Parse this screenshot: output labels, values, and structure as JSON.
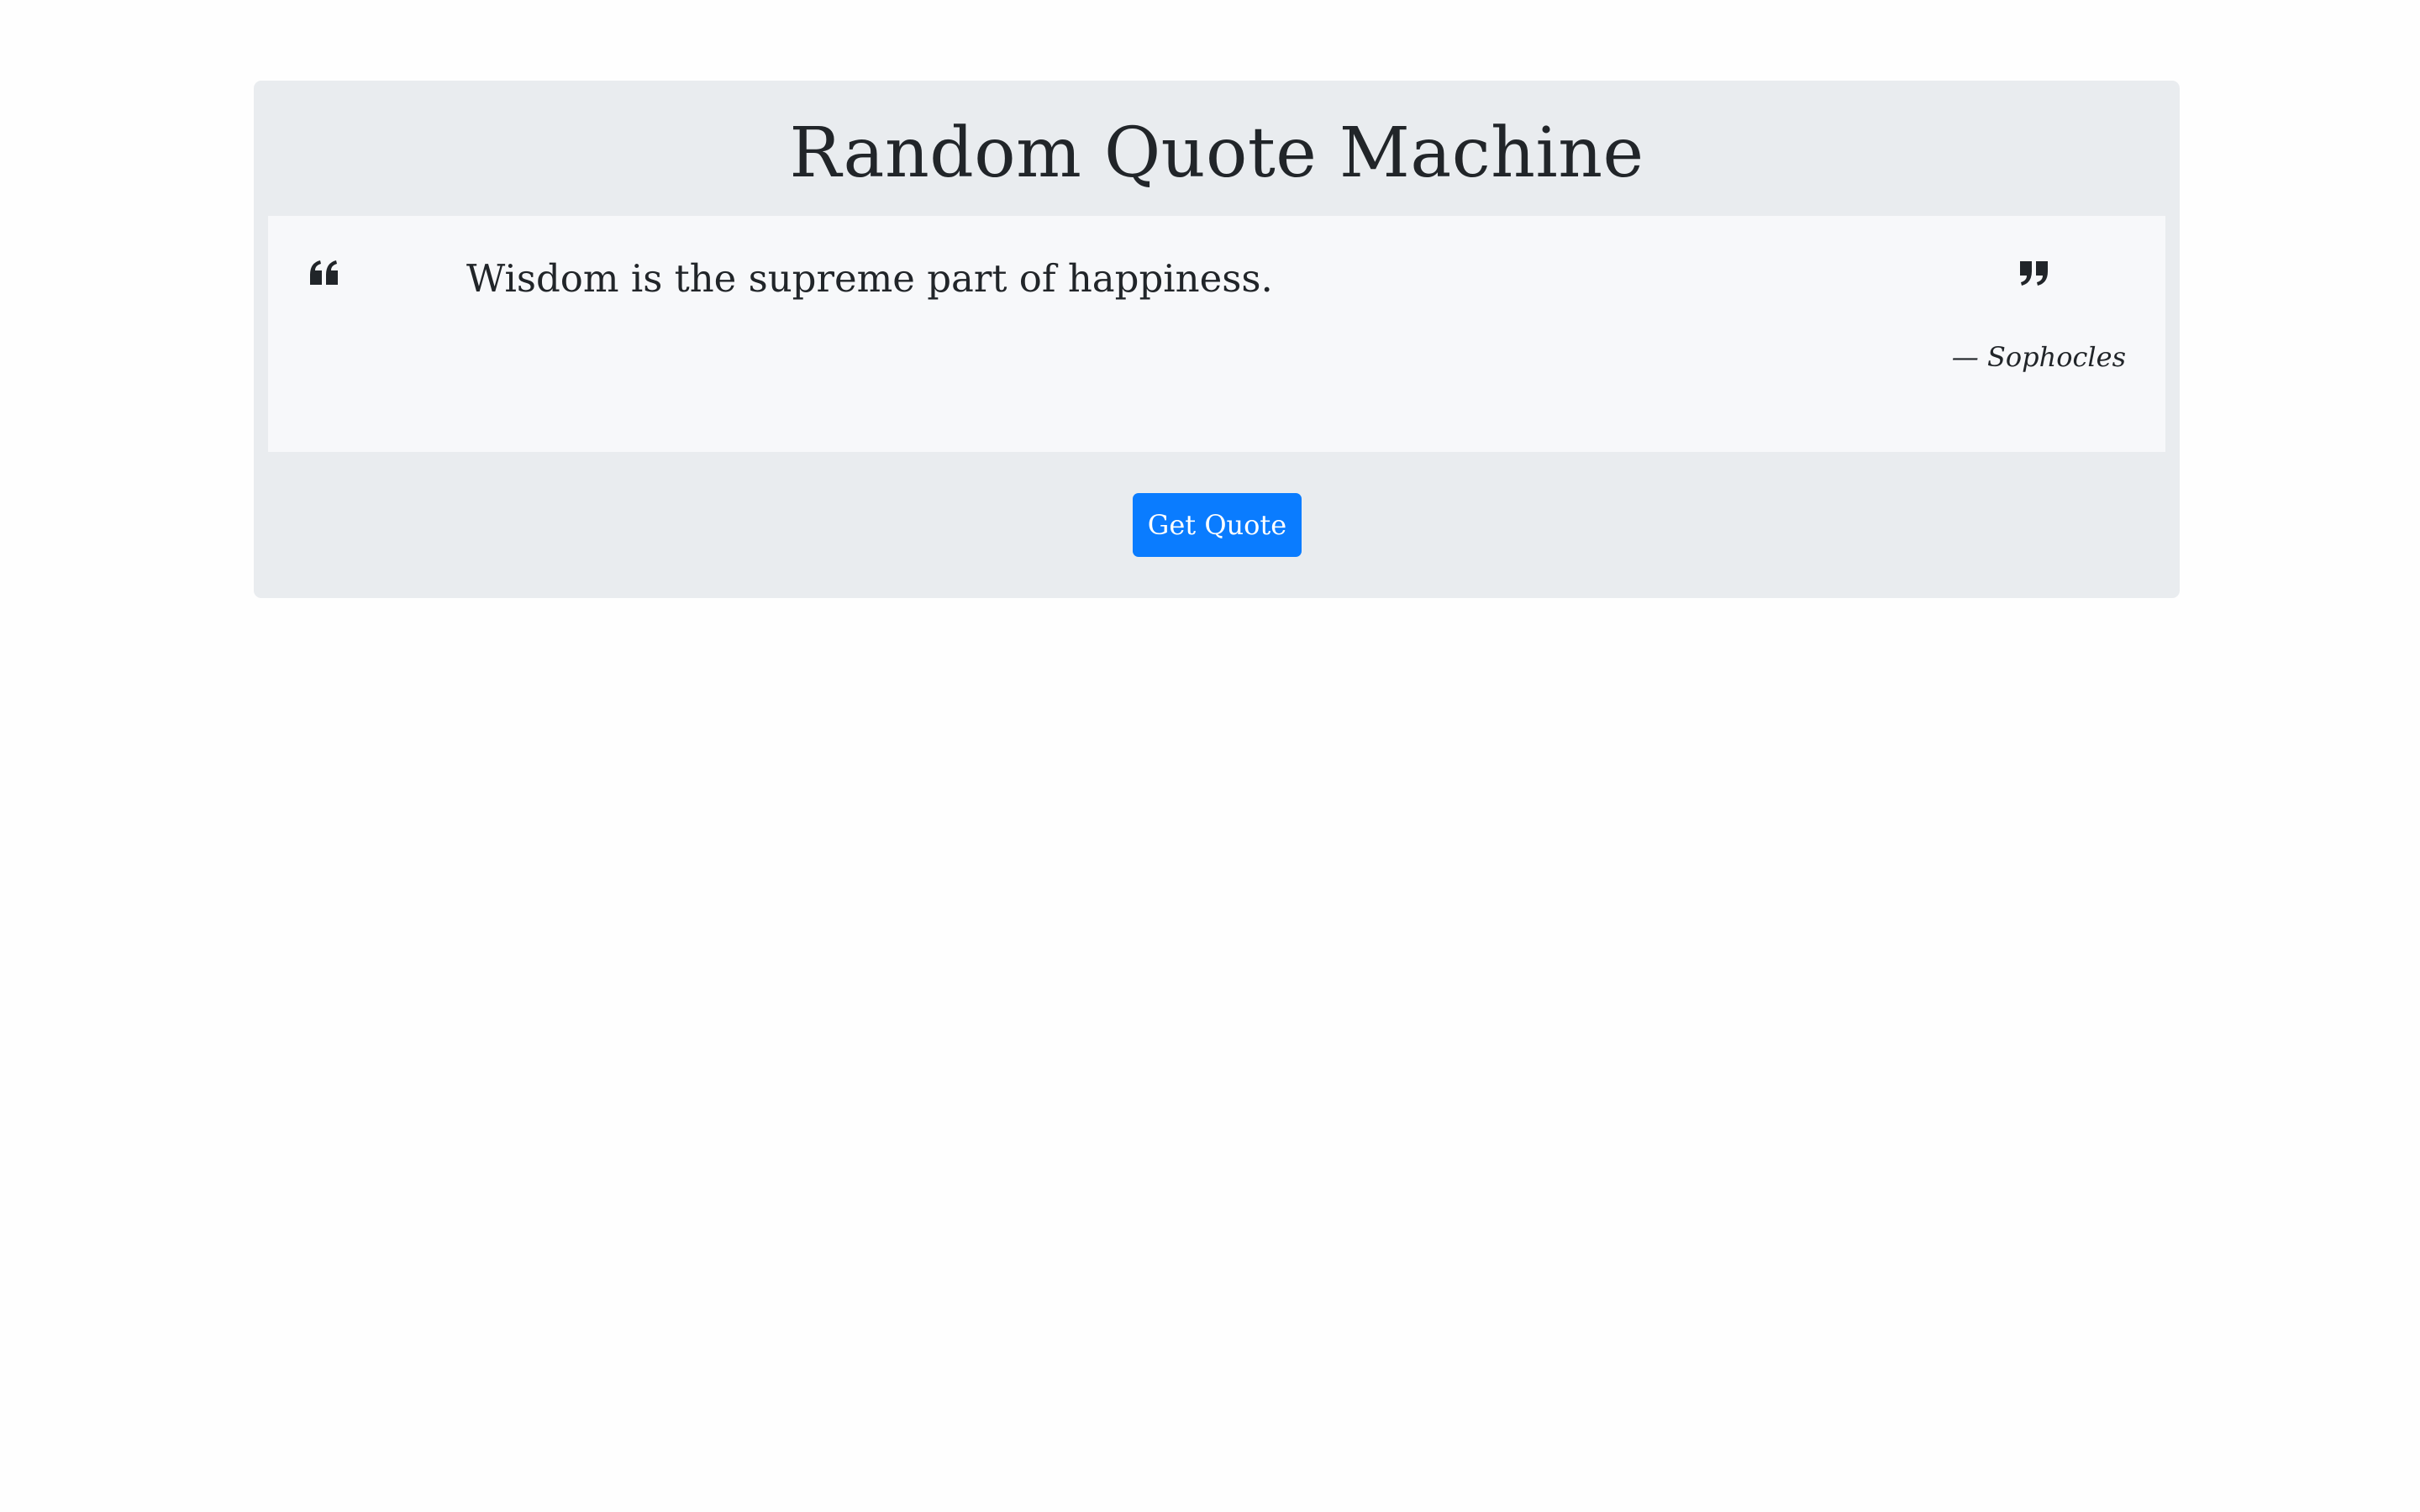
{
  "page": {
    "title": "Random Quote Machine"
  },
  "quote": {
    "text": "Wisdom is the supreme part of happiness.",
    "author": "— Sophocles",
    "open_icon": "quote-left-icon",
    "close_icon": "quote-right-icon"
  },
  "actions": {
    "get_quote_label": "Get Quote"
  },
  "colors": {
    "page_background": "#fefefe",
    "card_background": "#e9ecef",
    "quote_background": "#f7f8fa",
    "text": "#212529",
    "button": "#0a7cff",
    "button_text": "#ffffff"
  }
}
